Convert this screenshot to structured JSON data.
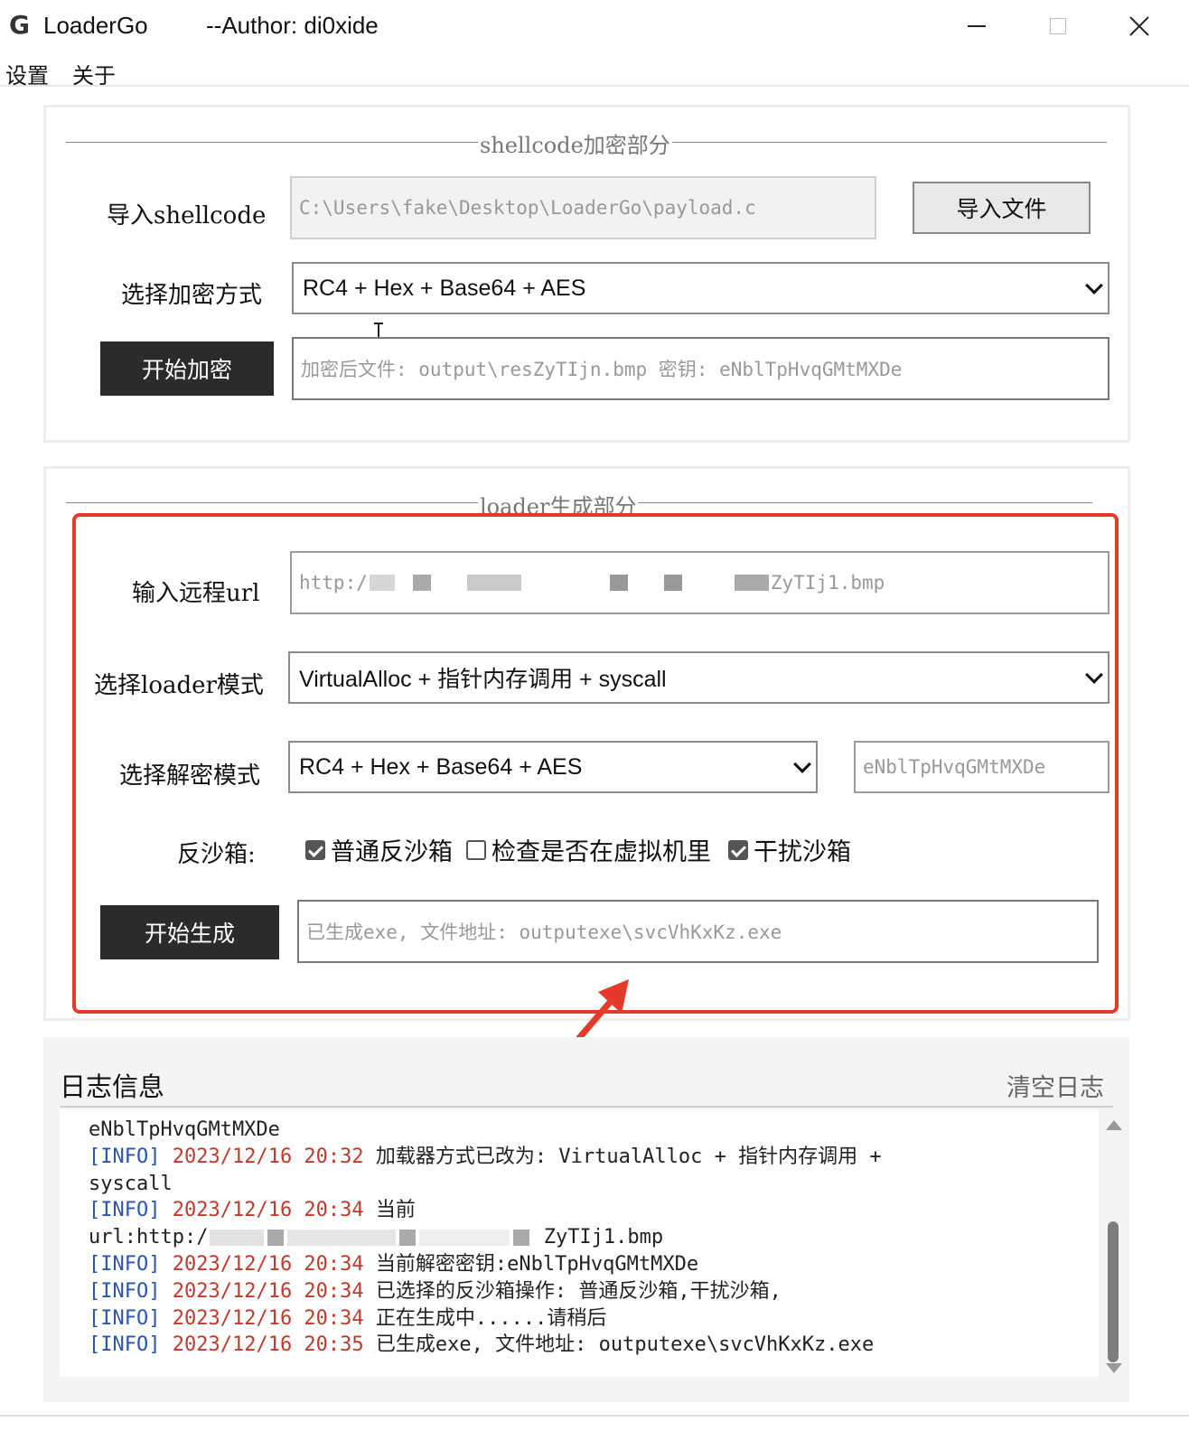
{
  "window": {
    "icon_glyph": "G",
    "title": "LoaderGo",
    "author": "--Author: di0xide"
  },
  "menu": {
    "items": [
      "设置",
      "关于"
    ]
  },
  "encrypt_section": {
    "title": "shellcode加密部分",
    "import_label": "导入shellcode",
    "import_path": "C:\\Users\\fake\\Desktop\\LoaderGo\\payload.c",
    "import_button": "导入文件",
    "method_label": "选择加密方式",
    "method_value": "RC4 + Hex + Base64 + AES",
    "start_button": "开始加密",
    "result": "加密后文件: output\\resZyTIjn.bmp 密钥: eNblTpHvqGMtMXDe"
  },
  "loader_section": {
    "title": "loader生成部分",
    "url_label": "输入远程url",
    "url_prefix": "http:/",
    "url_suffix": "ZyTIj1.bmp",
    "loader_label": "选择loader模式",
    "loader_value": "VirtualAlloc + 指针内存调用 + syscall",
    "decrypt_label": "选择解密模式",
    "decrypt_value": "RC4 + Hex + Base64 + AES",
    "key_value": "eNblTpHvqGMtMXDe",
    "sandbox_label": "反沙箱:",
    "sandbox_options": [
      {
        "label": "普通反沙箱",
        "checked": true
      },
      {
        "label": "检查是否在虚拟机里",
        "checked": false
      },
      {
        "label": "干扰沙箱",
        "checked": true
      }
    ],
    "generate_button": "开始生成",
    "generate_result": "已生成exe, 文件地址: outputexe\\svcVhKxKz.exe"
  },
  "log": {
    "title": "日志信息",
    "clear_button": "清空日志",
    "lines": [
      {
        "text": "eNblTpHvqGMtMXDe"
      },
      {
        "tag": "[INFO]",
        "time": "2023/12/16 20:32",
        "text": "加载器方式已改为: VirtualAlloc + 指针内存调用 +"
      },
      {
        "text": "syscall"
      },
      {
        "tag": "[INFO]",
        "time": "2023/12/16 20:34",
        "text": "当前"
      },
      {
        "text": "url:http:/",
        "suffix": "ZyTIj1.bmp",
        "redacted": true
      },
      {
        "tag": "[INFO]",
        "time": "2023/12/16 20:34",
        "text": "当前解密密钥:eNblTpHvqGMtMXDe"
      },
      {
        "tag": "[INFO]",
        "time": "2023/12/16 20:34",
        "text": "已选择的反沙箱操作: 普通反沙箱,干扰沙箱,"
      },
      {
        "tag": "[INFO]",
        "time": "2023/12/16 20:34",
        "text": "正在生成中......请稍后"
      },
      {
        "tag": "[INFO]",
        "time": "2023/12/16 20:35",
        "text": "已生成exe, 文件地址: outputexe\\svcVhKxKz.exe"
      }
    ]
  },
  "colors": {
    "annotation": "#e5392a",
    "log_tag": "#2b55b4",
    "log_time": "#c0392b",
    "dark_button": "#2b2b2b"
  },
  "icons": [
    "app-logo-icon",
    "minimize-icon",
    "maximize-icon",
    "close-icon",
    "chevron-down-icon",
    "checkbox-icon",
    "scroll-up-icon",
    "scroll-down-icon",
    "text-cursor-icon",
    "arrow-annotation-icon"
  ]
}
